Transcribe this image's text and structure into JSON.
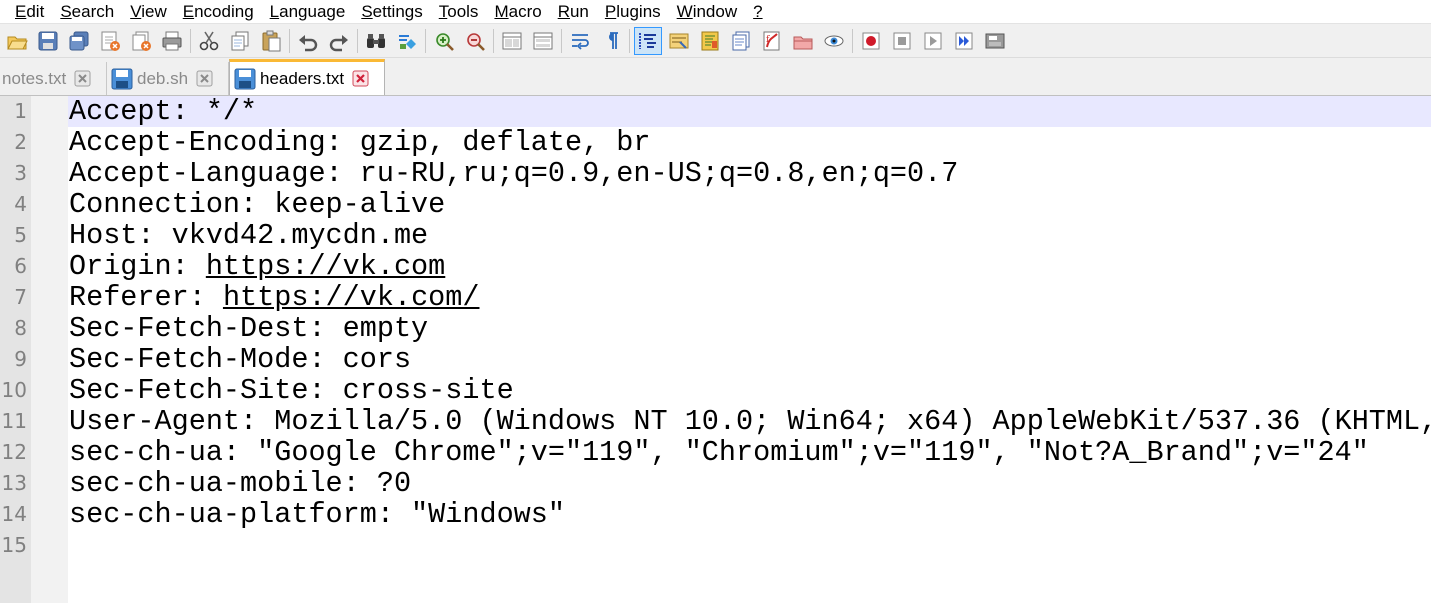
{
  "menu": [
    {
      "label": "Edit",
      "u": "E",
      "rest": "dit"
    },
    {
      "label": "Search",
      "u": "S",
      "rest": "earch"
    },
    {
      "label": "View",
      "u": "V",
      "rest": "iew"
    },
    {
      "label": "Encoding",
      "u": "E",
      "rest": "ncoding"
    },
    {
      "label": "Language",
      "u": "L",
      "rest": "anguage"
    },
    {
      "label": "Settings",
      "u": "S",
      "rest": "ettings"
    },
    {
      "label": "Tools",
      "u": "T",
      "rest": "ools"
    },
    {
      "label": "Macro",
      "u": "M",
      "rest": "acro"
    },
    {
      "label": "Run",
      "u": "R",
      "rest": "un"
    },
    {
      "label": "Plugins",
      "u": "P",
      "rest": "lugins"
    },
    {
      "label": "Window",
      "u": "W",
      "rest": "indow"
    },
    {
      "label": "?",
      "u": "?",
      "rest": ""
    }
  ],
  "tabs": [
    {
      "label": "notes.txt",
      "active": false
    },
    {
      "label": "deb.sh",
      "active": false
    },
    {
      "label": "headers.txt",
      "active": true
    }
  ],
  "editor": {
    "current_line": 1,
    "lines": [
      {
        "n": "1",
        "pre": "Accept: */*",
        "link": "",
        "post": ""
      },
      {
        "n": "2",
        "pre": "Accept-Encoding: gzip, deflate, br",
        "link": "",
        "post": ""
      },
      {
        "n": "3",
        "pre": "Accept-Language: ru-RU,ru;q=0.9,en-US;q=0.8,en;q=0.7",
        "link": "",
        "post": ""
      },
      {
        "n": "4",
        "pre": "Connection: keep-alive",
        "link": "",
        "post": ""
      },
      {
        "n": "5",
        "pre": "Host: vkvd42.mycdn.me",
        "link": "",
        "post": ""
      },
      {
        "n": "6",
        "pre": "Origin: ",
        "link": "https://vk.com",
        "post": ""
      },
      {
        "n": "7",
        "pre": "Referer: ",
        "link": "https://vk.com/",
        "post": ""
      },
      {
        "n": "8",
        "pre": "Sec-Fetch-Dest: empty",
        "link": "",
        "post": ""
      },
      {
        "n": "9",
        "pre": "Sec-Fetch-Mode: cors",
        "link": "",
        "post": ""
      },
      {
        "n": "10",
        "pre": "Sec-Fetch-Site: cross-site",
        "link": "",
        "post": ""
      },
      {
        "n": "11",
        "pre": "User-Agent: Mozilla/5.0 (Windows NT 10.0; Win64; x64) AppleWebKit/537.36 (KHTML,",
        "link": "",
        "post": ""
      },
      {
        "n": "12",
        "pre": "sec-ch-ua: \"Google Chrome\";v=\"119\", \"Chromium\";v=\"119\", \"Not?A_Brand\";v=\"24\"",
        "link": "",
        "post": ""
      },
      {
        "n": "13",
        "pre": "sec-ch-ua-mobile: ?0",
        "link": "",
        "post": ""
      },
      {
        "n": "14",
        "pre": "sec-ch-ua-platform: \"Windows\"",
        "link": "",
        "post": ""
      },
      {
        "n": "15",
        "pre": "",
        "link": "",
        "post": ""
      }
    ]
  },
  "toolbar": {
    "icons": [
      "open-file-icon",
      "save-icon",
      "save-all-icon",
      "close-icon",
      "close-all-icon",
      "print-icon",
      "|",
      "cut-icon",
      "copy-icon",
      "paste-icon",
      "|",
      "undo-icon",
      "redo-icon",
      "|",
      "find-icon",
      "replace-icon",
      "|",
      "zoom-in-icon",
      "zoom-out-icon",
      "|",
      "sync-vertical-icon",
      "sync-horizontal-icon",
      "|",
      "word-wrap-icon",
      "show-all-chars-icon",
      "|",
      "indent-guide-icon",
      "user-language-icon",
      "doc-map-icon",
      "function-list-icon",
      "folder-workspace-icon",
      "doc-switcher-icon",
      "monitoring-icon",
      "|",
      "record-macro-icon",
      "stop-macro-icon",
      "play-macro-icon",
      "run-macro-multiple-icon",
      "save-macro-icon"
    ],
    "active_icon": "indent-guide-icon"
  }
}
